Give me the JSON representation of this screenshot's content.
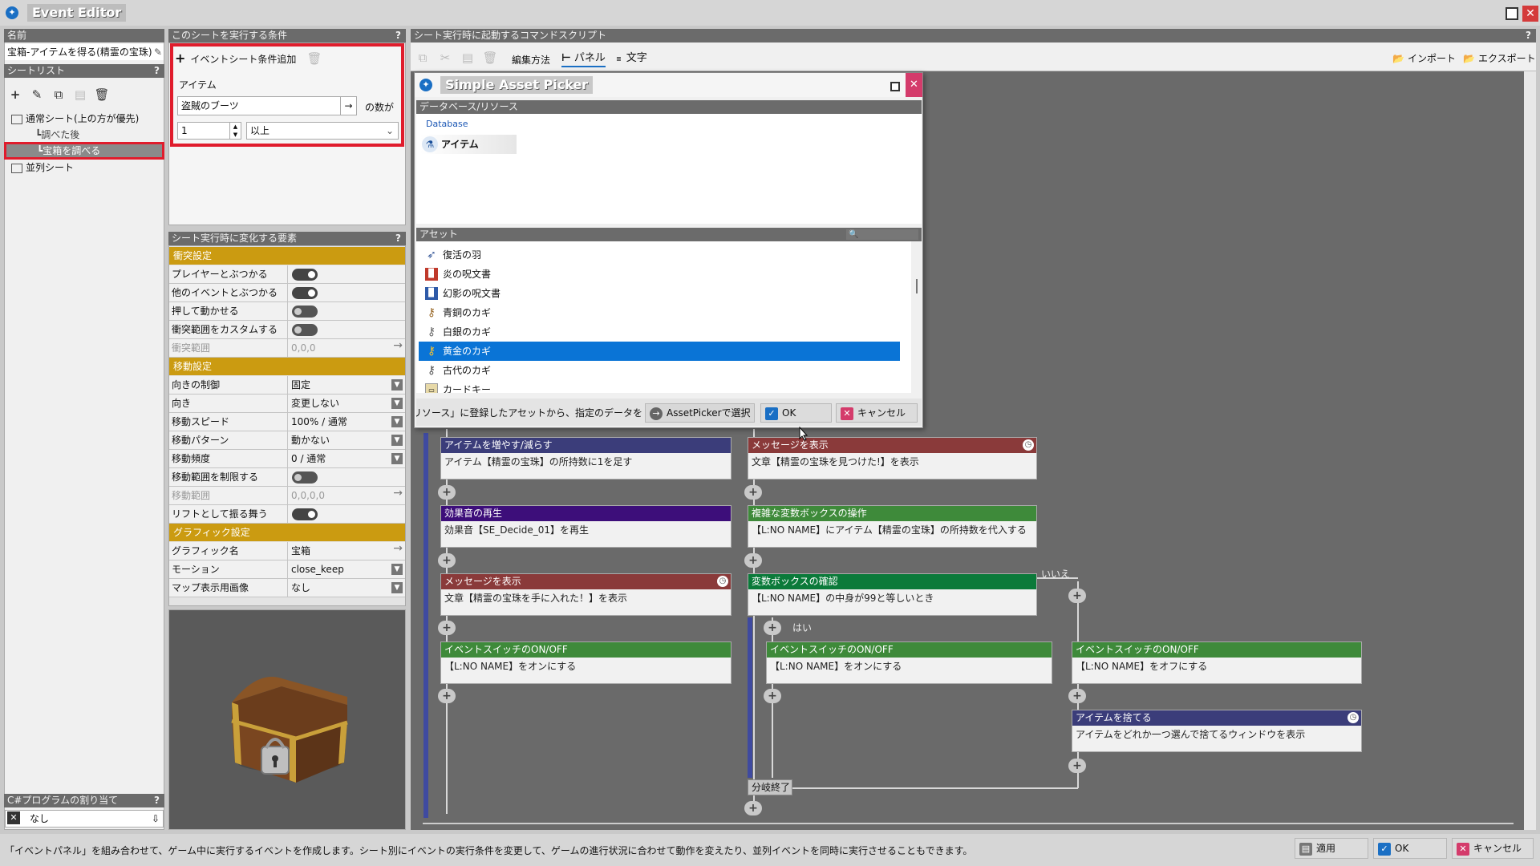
{
  "window": {
    "title": "Event Editor"
  },
  "left": {
    "name_header": "名前",
    "name_value": "宝箱-アイテムを得る(精霊の宝珠)",
    "sheetlist_header": "シートリスト",
    "tree": [
      {
        "label": "通常シート(上の方が優先)"
      },
      {
        "label": "調べた後"
      },
      {
        "label": "宝箱を調べる"
      },
      {
        "label": "並列シート"
      }
    ],
    "csharp_header": "C#プログラムの割り当て",
    "csharp_value": "なし"
  },
  "cond": {
    "header": "このシートを実行する条件",
    "add_label": "イベントシート条件追加",
    "item_label": "アイテム",
    "item_value": "盗賊のブーツ",
    "count_suffix": "の数が",
    "number_value": "1",
    "compare_value": "以上"
  },
  "props": {
    "header": "シート実行時に変化する要素",
    "cat_collision": "衝突設定",
    "cat_move": "移動設定",
    "cat_graphic": "グラフィック設定",
    "rows": [
      {
        "name": "プレイヤーとぶつかる",
        "value": "on"
      },
      {
        "name": "他のイベントとぶつかる",
        "value": "on"
      },
      {
        "name": "押して動かせる",
        "value": "off"
      },
      {
        "name": "衝突範囲をカスタムする",
        "value": "off"
      },
      {
        "name": "衝突範囲",
        "value": "0,0,0"
      },
      {
        "name": "向きの制御",
        "value": "固定"
      },
      {
        "name": "向き",
        "value": "変更しない"
      },
      {
        "name": "移動スピード",
        "value": "100% / 通常"
      },
      {
        "name": "移動パターン",
        "value": "動かない"
      },
      {
        "name": "移動頻度",
        "value": "0 / 通常"
      },
      {
        "name": "移動範囲を制限する",
        "value": "off"
      },
      {
        "name": "移動範囲",
        "value": "0,0,0,0"
      },
      {
        "name": "リフトとして振る舞う",
        "value": "on"
      },
      {
        "name": "グラフィック名",
        "value": "宝箱"
      },
      {
        "name": "モーション",
        "value": "close_keep"
      },
      {
        "name": "マップ表示用画像",
        "value": "なし"
      }
    ]
  },
  "script": {
    "header": "シート実行時に起動するコマンドスクリプト",
    "edit_method": "編集方法",
    "panel": "パネル",
    "text": "文字",
    "import": "インポート",
    "export": "エクスポート",
    "blocks": [
      {
        "title": "アイテムを増やす/減らす",
        "body": "アイテム【精霊の宝珠】の所持数に1を足す",
        "color": "#3b3d7a"
      },
      {
        "title": "効果音の再生",
        "body": "効果音【SE_Decide_01】を再生",
        "color": "#3d0e7a"
      },
      {
        "title": "メッセージを表示",
        "body": "文章【精霊の宝珠を手に入れた！】を表示",
        "color": "#8a3a3a"
      },
      {
        "title": "イベントスイッチのON/OFF",
        "body": "【L:NO  NAME】をオンにする",
        "color": "#3e8a3a"
      },
      {
        "title": "メッセージを表示",
        "body": "文章【精霊の宝珠を見つけた!】を表示",
        "color": "#8a3a3a"
      },
      {
        "title": "複雑な変数ボックスの操作",
        "body": "【L:NO  NAME】にアイテム【精霊の宝珠】の所持数を代入する",
        "color": "#3e8a3a"
      },
      {
        "title": "変数ボックスの確認",
        "body": "【L:NO  NAME】の中身が99と等しいとき",
        "color": "#0b7a3a"
      },
      {
        "title": "イベントスイッチのON/OFF",
        "body": "【L:NO  NAME】をオンにする",
        "color": "#3e8a3a"
      },
      {
        "title": "イベントスイッチのON/OFF",
        "body": "【L:NO  NAME】をオフにする",
        "color": "#3e8a3a"
      },
      {
        "title": "アイテムを捨てる",
        "body": "アイテムをどれか一つ選んで捨てるウィンドウを表示",
        "color": "#3b3d7a"
      }
    ],
    "no_label": "いいえ",
    "yes_label": "はい",
    "branch_end": "分岐終了"
  },
  "picker": {
    "title": "Simple Asset Picker",
    "db_header": "データベース/リソース",
    "db_label": "Database",
    "db_item": "アイテム",
    "asset_header": "アセット",
    "assets": [
      {
        "label": "復活の羽",
        "icon": "feather-icon"
      },
      {
        "label": "炎の呪文書",
        "icon": "red-book-icon"
      },
      {
        "label": "幻影の呪文書",
        "icon": "blue-book-icon"
      },
      {
        "label": "青銅のカギ",
        "icon": "bronze-key-icon"
      },
      {
        "label": "白銀のカギ",
        "icon": "silver-key-icon"
      },
      {
        "label": "黄金のカギ",
        "icon": "gold-key-icon"
      },
      {
        "label": "古代のカギ",
        "icon": "ancient-key-icon"
      },
      {
        "label": "カードキー",
        "icon": "card-key-icon"
      }
    ],
    "footer_text": "ス」や「リソース」に登録したアセットから、指定のデータを",
    "assetpicker_btn": "AssetPickerで選択",
    "ok": "OK",
    "cancel": "キャンセル"
  },
  "status": {
    "text": "「イベントパネル」を組み合わせて、ゲーム中に実行するイベントを作成します。シート別にイベントの実行条件を変更して、ゲームの進行状況に合わせて動作を変えたり、並列イベントを同時に実行させることもできます。",
    "apply": "適用",
    "ok": "OK",
    "cancel": "キャンセル"
  }
}
